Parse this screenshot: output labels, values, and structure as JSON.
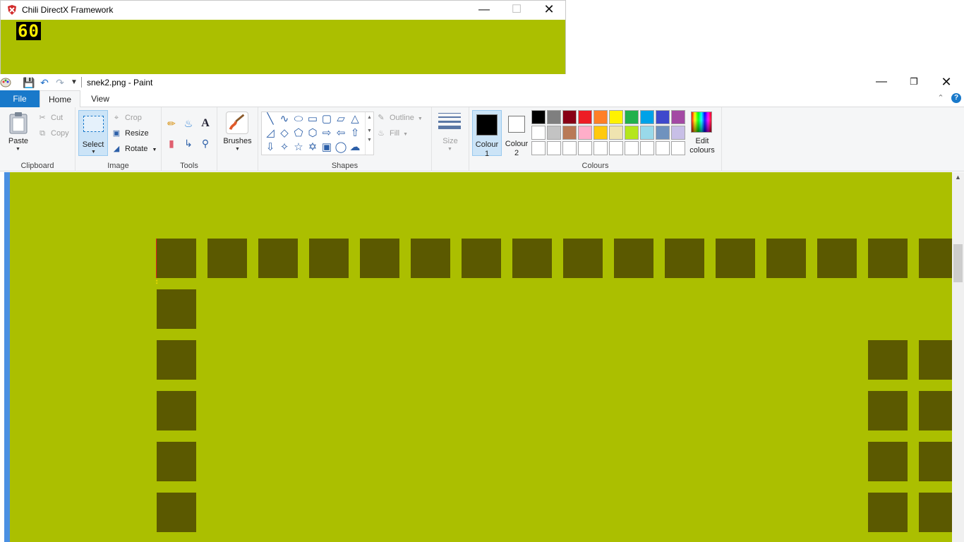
{
  "dx_window": {
    "title": "Chili DirectX Framework",
    "fps": "60",
    "canvas_color": "#abbf00"
  },
  "paint": {
    "title": "snek2.png - Paint",
    "qat": {
      "save_icon": "save-icon",
      "undo_icon": "undo-icon",
      "redo_icon": "redo-icon",
      "customize_icon": "dropdown-icon"
    },
    "tabs": {
      "file": "File",
      "home": "Home",
      "view": "View"
    },
    "ribbon": {
      "clipboard": {
        "label": "Clipboard",
        "paste": "Paste",
        "cut": "Cut",
        "copy": "Copy"
      },
      "image": {
        "label": "Image",
        "select": "Select",
        "crop": "Crop",
        "resize": "Resize",
        "rotate": "Rotate"
      },
      "tools": {
        "label": "Tools"
      },
      "brushes": {
        "label": "Brushes"
      },
      "shapes": {
        "label": "Shapes",
        "outline": "Outline",
        "fill": "Fill"
      },
      "size": {
        "label": "Size"
      },
      "colours": {
        "label": "Colours",
        "colour1": "Colour 1",
        "colour2": "Colour 2",
        "colour1_value": "#000000",
        "colour2_value": "#ffffff",
        "edit": "Edit colours",
        "palette_row1": [
          "#000000",
          "#7f7f7f",
          "#880015",
          "#ed1c24",
          "#ff7f27",
          "#fff200",
          "#22b14c",
          "#00a2e8",
          "#3f48cc",
          "#a349a4"
        ],
        "palette_row2": [
          "#ffffff",
          "#c3c3c3",
          "#b97a57",
          "#ffaec9",
          "#ffc90e",
          "#efe4b0",
          "#b5e61d",
          "#99d9ea",
          "#7092be",
          "#c8bfe7"
        ],
        "palette_row3": [
          "#ffffff",
          "#ffffff",
          "#ffffff",
          "#ffffff",
          "#ffffff",
          "#ffffff",
          "#ffffff",
          "#ffffff",
          "#ffffff",
          "#ffffff"
        ]
      }
    },
    "canvas": {
      "background": "#abbf00",
      "block_color": "#5b5900"
    }
  }
}
